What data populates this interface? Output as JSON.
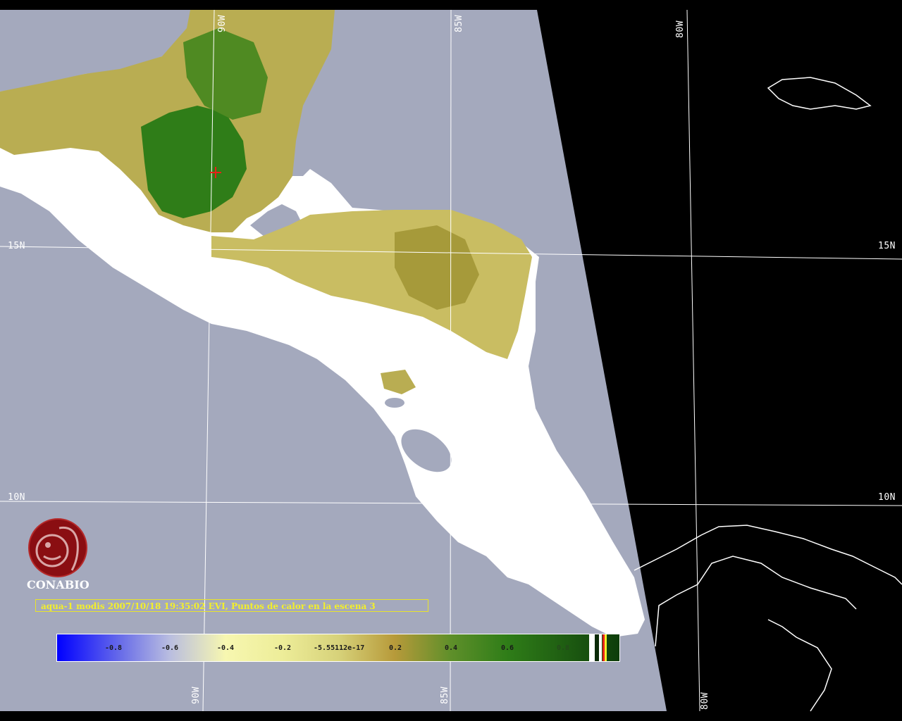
{
  "map": {
    "colors": {
      "ocean": "#a4a9bd",
      "outside_scene": "#000000",
      "clouds": "#ffffff",
      "vegetation_dark": "#2f7d18",
      "vegetation_mid": "#9c9a35",
      "vegetation_light": "#d8cc74",
      "graticule": "#ffffff",
      "hotspot_marker": "#e8201a"
    },
    "graticule_labels": {
      "lon_90w_top": "90W",
      "lon_85w_top": "85W",
      "lon_80w_top": "80W",
      "lon_90w_bottom": "90W",
      "lon_85w_bottom": "85W",
      "lon_80w_bottom": "80W",
      "lat_15n_left": "15N",
      "lat_15n_right": "15N",
      "lat_10n_left": "10N",
      "lat_10n_right": "10N"
    },
    "hotspot_count": 1
  },
  "logo": {
    "name": "CONABIO",
    "icon": "conabio-macaw-logo-icon"
  },
  "caption": "aqua-1 modis 2007/10/18 19:35:02 EVI, Puntos de calor en la escena 3",
  "colorbar": {
    "ticks": [
      "-0.8",
      "-0.6",
      "-0.4",
      "-0.2",
      "-5.55112e-17",
      "0.2",
      "0.4",
      "0.6",
      "0.8"
    ]
  }
}
